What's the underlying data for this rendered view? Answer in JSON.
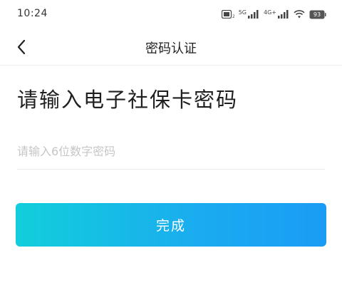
{
  "status_bar": {
    "time": "10:24",
    "network_1": "5G",
    "network_2": "4G+",
    "battery": "93"
  },
  "nav": {
    "title": "密码认证"
  },
  "heading": "请输入电子社保卡密码",
  "pin_field": {
    "value": "",
    "placeholder": "请输入6位数字密码"
  },
  "submit": {
    "label": "完成"
  },
  "colors": {
    "button_gradient_start": "#12cedb",
    "button_gradient_end": "#1a9cf5"
  }
}
